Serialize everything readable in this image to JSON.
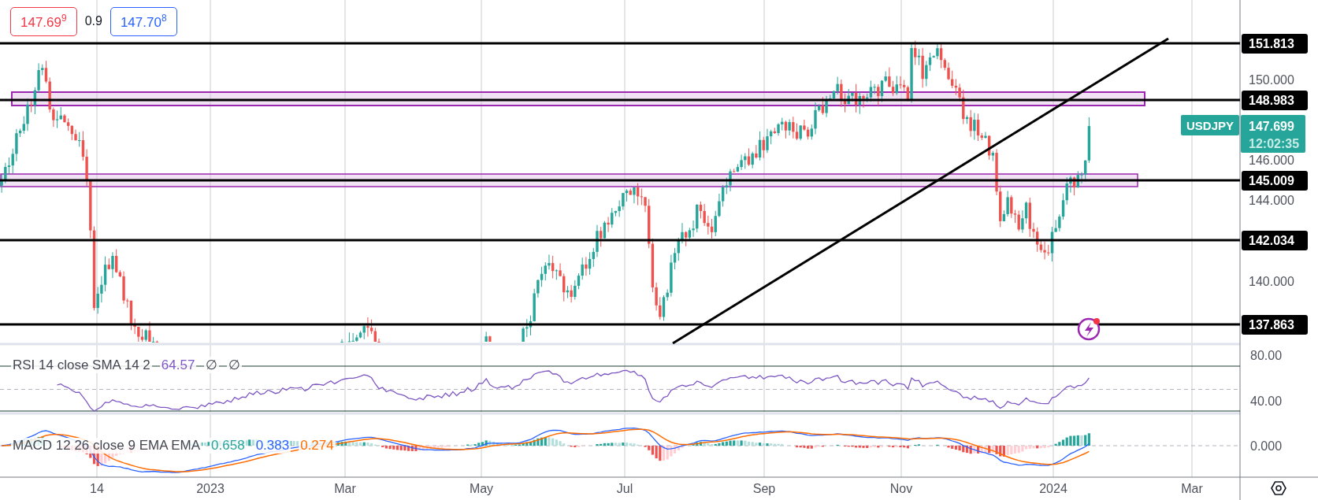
{
  "quote": {
    "bid": "147.69$^{9}$",
    "spread": "0.9",
    "ask": "147.70$^{8}$"
  },
  "price_axis": {
    "ticks": [
      "150.000",
      "146.000",
      "144.000",
      "140.000"
    ]
  },
  "horizontal_levels": [
    {
      "label": "151.813"
    },
    {
      "label": "148.983"
    },
    {
      "label": "145.009"
    },
    {
      "label": "142.034"
    },
    {
      "label": "137.863"
    }
  ],
  "symbol_tag": {
    "symbol": "USDJPY",
    "price": "147.699",
    "countdown": "12:02:35"
  },
  "rsi": {
    "legend": "RSI 14 close SMA 14 2",
    "value": "64.57",
    "extras": [
      "∅",
      "∅"
    ],
    "axis_ticks": [
      "80.00",
      "40.00"
    ]
  },
  "macd": {
    "legend": "MACD 12 26 close 9 EMA EMA",
    "values": [
      {
        "text": "0.658",
        "color": "#26a69a"
      },
      {
        "text": "0.383",
        "color": "#2962ff"
      },
      {
        "text": "0.274",
        "color": "#ff6d00"
      }
    ],
    "axis_ticks": [
      "0.000"
    ]
  },
  "time_axis": {
    "labels": [
      "14",
      "2023",
      "Mar",
      "May",
      "Jul",
      "Sep",
      "Nov",
      "2024",
      "Mar"
    ]
  }
}
